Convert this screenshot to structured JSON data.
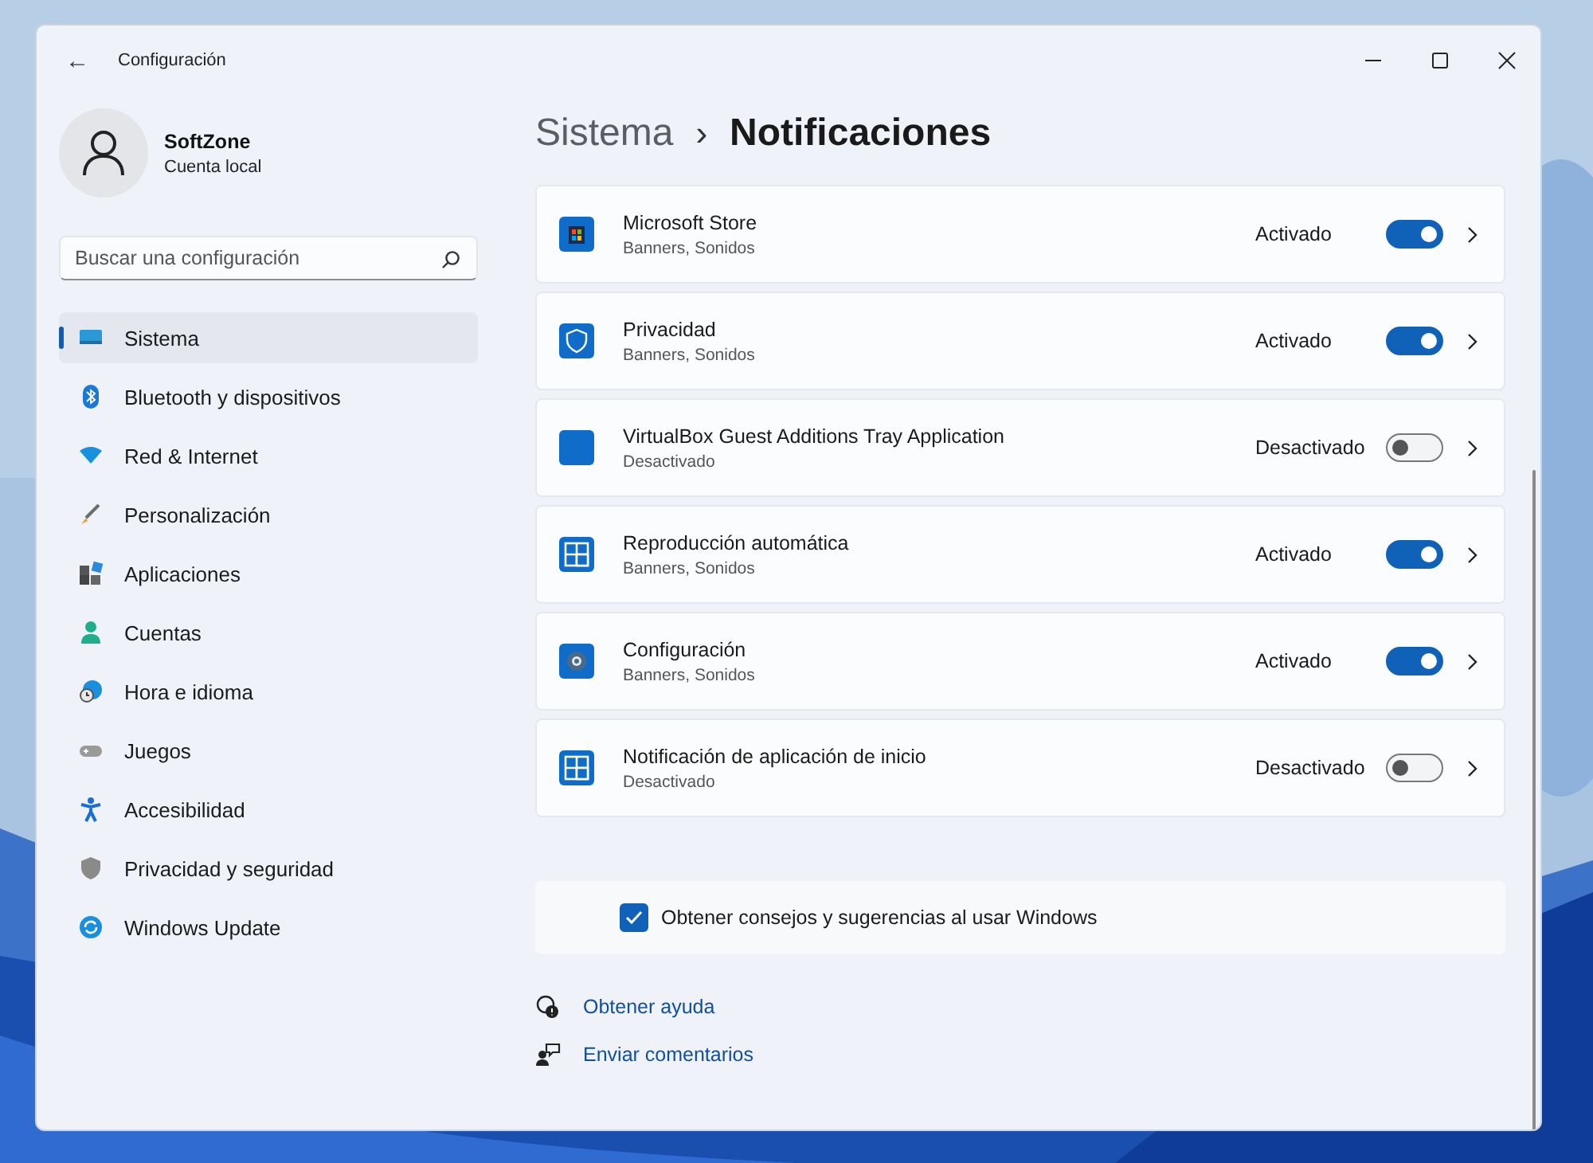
{
  "window": {
    "title": "Configuración",
    "back": "←"
  },
  "account": {
    "name": "SoftZone",
    "type": "Cuenta local"
  },
  "search": {
    "placeholder": "Buscar una configuración"
  },
  "sidebar": {
    "items": [
      {
        "label": "Sistema",
        "selected": true
      },
      {
        "label": "Bluetooth y dispositivos",
        "selected": false
      },
      {
        "label": "Red & Internet",
        "selected": false
      },
      {
        "label": "Personalización",
        "selected": false
      },
      {
        "label": "Aplicaciones",
        "selected": false
      },
      {
        "label": "Cuentas",
        "selected": false
      },
      {
        "label": "Hora e idioma",
        "selected": false
      },
      {
        "label": "Juegos",
        "selected": false
      },
      {
        "label": "Accesibilidad",
        "selected": false
      },
      {
        "label": "Privacidad y seguridad",
        "selected": false
      },
      {
        "label": "Windows Update",
        "selected": false
      }
    ]
  },
  "breadcrumb": {
    "parent": "Sistema",
    "separator": "›",
    "current": "Notificaciones"
  },
  "apps": [
    {
      "name": "Microsoft Store",
      "detail": "Banners, Sonidos",
      "status": "Activado",
      "on": true
    },
    {
      "name": "Privacidad",
      "detail": "Banners, Sonidos",
      "status": "Activado",
      "on": true
    },
    {
      "name": "VirtualBox Guest Additions Tray Application",
      "detail": "Desactivado",
      "status": "Desactivado",
      "on": false
    },
    {
      "name": "Reproducción automática",
      "detail": "Banners, Sonidos",
      "status": "Activado",
      "on": true
    },
    {
      "name": "Configuración",
      "detail": "Banners, Sonidos",
      "status": "Activado",
      "on": true
    },
    {
      "name": "Notificación de aplicación de inicio",
      "detail": "Desactivado",
      "status": "Desactivado",
      "on": false
    }
  ],
  "tips": {
    "label": "Obtener consejos y sugerencias al usar Windows",
    "checked": true
  },
  "links": [
    "Obtener ayuda",
    "Enviar comentarios"
  ]
}
